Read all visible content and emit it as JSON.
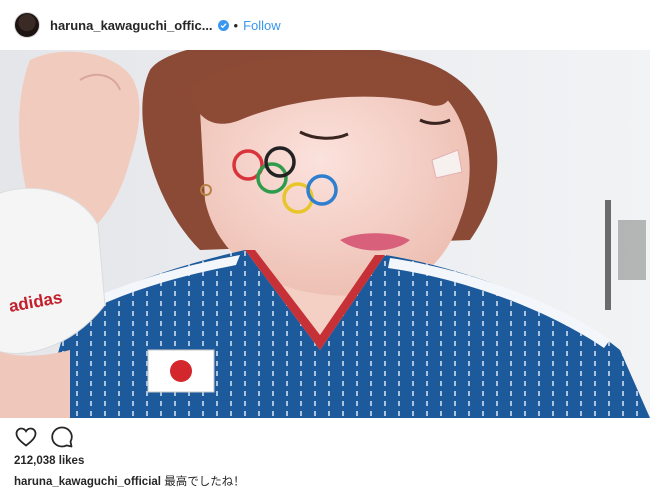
{
  "post": {
    "username": "haruna_kawaguchi_offic...",
    "separator": "•",
    "follow_label": "Follow",
    "likes": "212,038 likes",
    "caption_user": "haruna_kawaguchi_official",
    "caption_text": "最高でしたね！"
  },
  "photo": {
    "jersey_logo_text": "adidas",
    "flag_patch": "Japan flag",
    "face_paint": "Olympic rings"
  },
  "icons": {
    "verified": "verified-badge-icon",
    "like": "heart-icon",
    "comment": "comment-bubble-icon"
  },
  "colors": {
    "link": "#3897f0",
    "text": "#262626",
    "jersey": "#1b4f8f",
    "ring_blue": "#2f7fd0",
    "ring_yellow": "#e8c52a",
    "ring_black": "#222222",
    "ring_green": "#2f9b4c",
    "ring_red": "#d8343c"
  }
}
